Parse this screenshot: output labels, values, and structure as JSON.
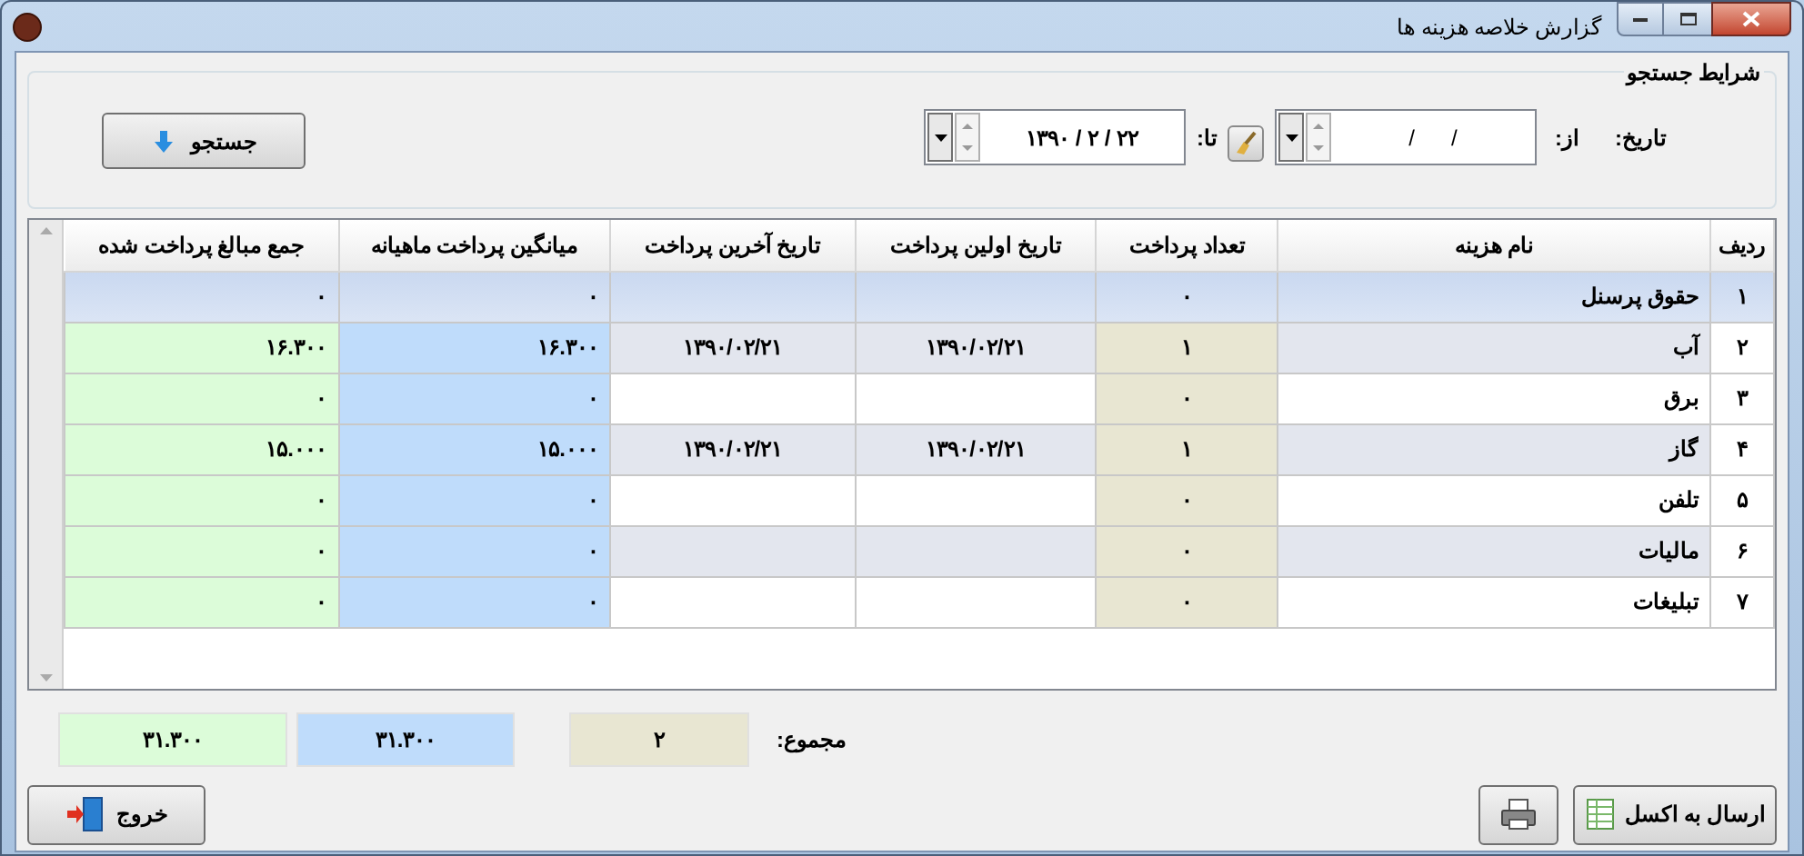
{
  "window": {
    "title": "گزارش خلاصه هزینه ها"
  },
  "search": {
    "group_title": "شرایط جستجو",
    "date_label": "تاریخ:",
    "from_label": "از:",
    "from_value": "/      /",
    "to_label": "تا:",
    "to_value": "۱۳۹۰ / ۲ / ۲۲",
    "button": "جستجو"
  },
  "table": {
    "columns": [
      "ردیف",
      "نام هزینه",
      "تعداد پرداخت",
      "تاریخ اولین پرداخت",
      "تاریخ آخرین پرداخت",
      "میانگین پرداخت ماهیانه",
      "جمع مبالغ پرداخت شده"
    ],
    "rows": [
      {
        "cells": [
          "۱",
          "حقوق پرسنل",
          "۰",
          "",
          "",
          "۰",
          "۰"
        ],
        "selected": true
      },
      {
        "cells": [
          "۲",
          "آب",
          "۱",
          "۱۳۹۰/۰۲/۲۱",
          "۱۳۹۰/۰۲/۲۱",
          "۱۶.۳۰۰",
          "۱۶.۳۰۰"
        ],
        "selected": false
      },
      {
        "cells": [
          "۳",
          "برق",
          "۰",
          "",
          "",
          "۰",
          "۰"
        ],
        "selected": false
      },
      {
        "cells": [
          "۴",
          "گاز",
          "۱",
          "۱۳۹۰/۰۲/۲۱",
          "۱۳۹۰/۰۲/۲۱",
          "۱۵.۰۰۰",
          "۱۵.۰۰۰"
        ],
        "selected": false
      },
      {
        "cells": [
          "۵",
          "تلفن",
          "۰",
          "",
          "",
          "۰",
          "۰"
        ],
        "selected": false
      },
      {
        "cells": [
          "۶",
          "مالیات",
          "۰",
          "",
          "",
          "۰",
          "۰"
        ],
        "selected": false
      },
      {
        "cells": [
          "۷",
          "تبلیغات",
          "۰",
          "",
          "",
          "۰",
          "۰"
        ],
        "selected": false
      }
    ]
  },
  "totals": {
    "label": "مجموع:",
    "count": "۲",
    "average": "۳۱.۳۰۰",
    "sum": "۳۱.۳۰۰"
  },
  "buttons": {
    "excel": "ارسال به اکسل",
    "exit": "خروج"
  }
}
